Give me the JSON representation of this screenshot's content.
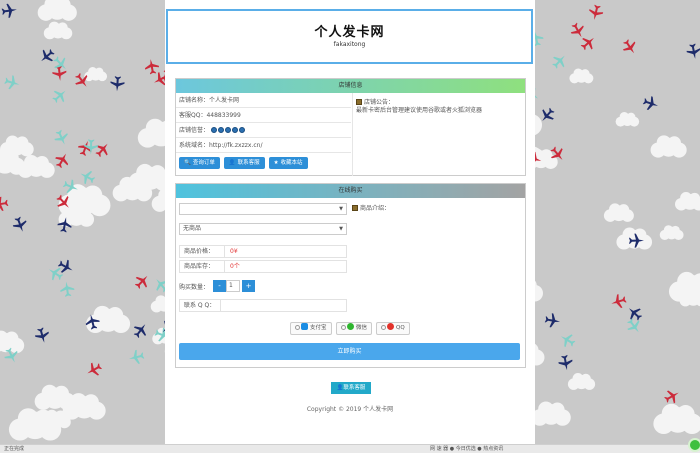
{
  "header": {
    "title": "个人发卡网",
    "subtitle": "fakaxitong"
  },
  "shop_info": {
    "heading": "店铺信息",
    "rows": [
      {
        "label": "店铺名称：",
        "value": "个人发卡网"
      },
      {
        "label": "客服QQ：",
        "value": "448833999"
      },
      {
        "label": "店铺信誉：",
        "value": ""
      },
      {
        "label": "系统域名：",
        "value": "http://fk.zxzzx.cn/"
      }
    ],
    "reputation_level": 5,
    "buttons": {
      "query_order": "查询订单",
      "contact_service": "联系客服",
      "favorite_shop": "收藏本站"
    },
    "notice_title": "店铺公告：",
    "notice_body": "最新卡密后台管理建议使用谷歌或者火狐浏览器"
  },
  "purchase": {
    "heading": "在线购买",
    "category_select": "",
    "product_select": "无商品",
    "price_label": "商品价格：",
    "price_value": "0¥",
    "stock_label": "商品库存：",
    "stock_value": "0个",
    "qty_label": "购买数量：",
    "qty_value": "1",
    "minus": "-",
    "plus": "+",
    "contact_label": "联系 Q Q：",
    "intro_label": "商品介绍：",
    "payments": [
      {
        "label": "支付宝",
        "color": "#1a8ce3"
      },
      {
        "label": "微信",
        "color": "#2fb52f"
      },
      {
        "label": "QQ",
        "color": "#e2322a"
      }
    ],
    "buy_button": "立即购买"
  },
  "footer": {
    "contact_button": "联系客服",
    "copyright": "Copyright © 2019 个人发卡网"
  },
  "statusbar": {
    "left": "正在完成",
    "right": "网 速 器  ●  今日优选  ●  热点资讯"
  },
  "colors": {
    "accent_blue": "#2d8fd8",
    "price_red": "#e23333",
    "header_border": "#5aaee8"
  }
}
